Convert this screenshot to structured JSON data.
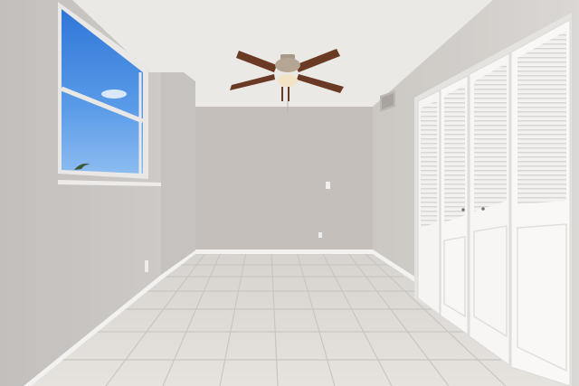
{
  "scene": {
    "kind": "photo",
    "subject": "empty-bedroom",
    "colors": {
      "ceiling": "#eceae6",
      "back_wall": "#c4bfbb",
      "left_wall": "#c9c5c2",
      "right_wall": "#d2cecb",
      "floor_tile": "#dedbd7",
      "grout": "#c8c4c0",
      "trim": "#f5f4f2",
      "closet": "#f7f6f4",
      "sky": "#3f86e0",
      "fan_blade": "#6b3a24",
      "fan_metal": "#a89a86"
    }
  },
  "icons": {
    "fan": "ceiling-fan-icon",
    "switch": "light-switch-icon",
    "vent": "air-vent-icon"
  }
}
